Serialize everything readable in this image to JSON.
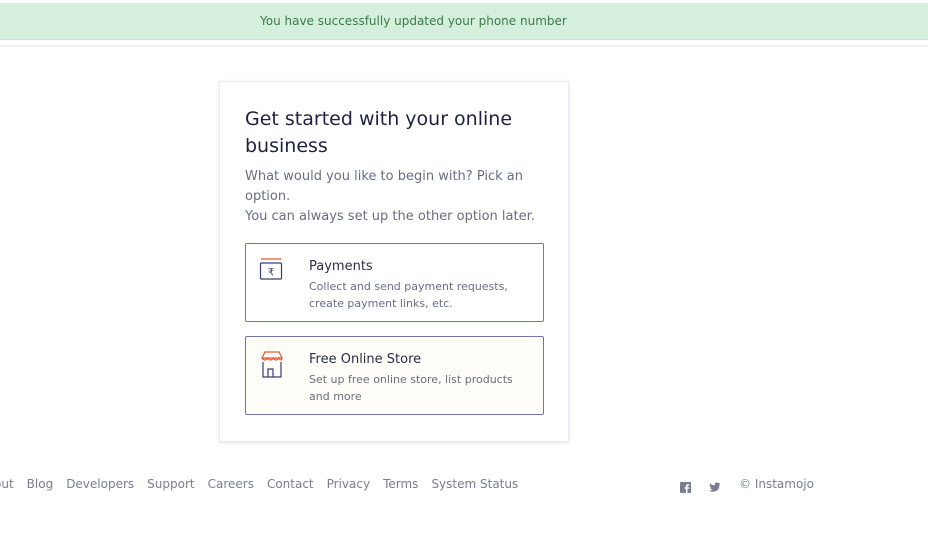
{
  "banner": {
    "message": "You have successfully updated your phone number"
  },
  "card": {
    "title": "Get started with your online business",
    "subtitle_line1": "What would you like to begin with? Pick an option.",
    "subtitle_line2": "You can always set up the other option later.",
    "options": [
      {
        "icon": "rupee-receipt-icon",
        "title": "Payments",
        "description": "Collect and send payment requests, create payment links, etc."
      },
      {
        "icon": "storefront-icon",
        "title": "Free Online Store",
        "description": "Set up free online store, list products and more"
      }
    ]
  },
  "footer": {
    "links": [
      "out",
      "Blog",
      "Developers",
      "Support",
      "Careers",
      "Contact",
      "Privacy",
      "Terms",
      "System Status"
    ],
    "social": [
      "facebook-icon",
      "twitter-icon"
    ],
    "copyright": "© Instamojo"
  },
  "colors": {
    "banner_bg": "#d4f0dc",
    "banner_text": "#3b7a4a",
    "option_border": "#7276a6",
    "title_text": "#1d2040",
    "icon_accent": "#e05a3a"
  }
}
